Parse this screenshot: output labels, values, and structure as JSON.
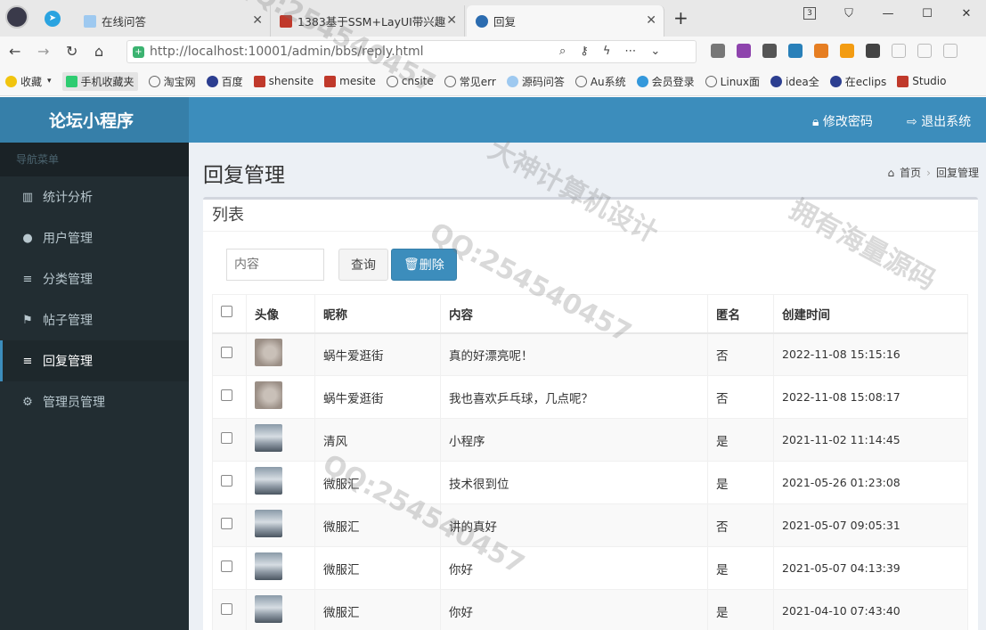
{
  "browser": {
    "tabs": [
      {
        "title": "在线问答"
      },
      {
        "title": "1383基于SSM+LayUI带兴趣"
      },
      {
        "title": "回复"
      }
    ],
    "url": "http://localhost:10001/admin/bbs/reply.html",
    "tab_count_badge": "3",
    "bookmarks": [
      "收藏",
      "手机收藏夹",
      "淘宝网",
      "百度",
      "shensite",
      "mesite",
      "cnsite",
      "常见err",
      "源码问答",
      "Au系统",
      "会员登录",
      "Linux面",
      "idea全",
      "在eclips",
      "Studio"
    ]
  },
  "app": {
    "logo": "论坛小程序",
    "change_password": "修改密码",
    "logout": "退出系统"
  },
  "sidebar": {
    "header": "导航菜单",
    "items": [
      {
        "label": "统计分析",
        "icon": "bar-chart-icon"
      },
      {
        "label": "用户管理",
        "icon": "user-icon"
      },
      {
        "label": "分类管理",
        "icon": "list-icon"
      },
      {
        "label": "帖子管理",
        "icon": "flag-icon"
      },
      {
        "label": "回复管理",
        "icon": "list-icon"
      },
      {
        "label": "管理员管理",
        "icon": "gear-icon"
      }
    ]
  },
  "page": {
    "title": "回复管理",
    "breadcrumb_home": "首页",
    "breadcrumb_current": "回复管理",
    "box_title": "列表",
    "search_placeholder": "内容",
    "query_button": "查询",
    "delete_button": "删除"
  },
  "table": {
    "headers": [
      "头像",
      "昵称",
      "内容",
      "匿名",
      "创建时间"
    ],
    "rows": [
      {
        "avatar": "av1",
        "nickname": "蜗牛爱逛街",
        "content": "真的好漂亮呢！",
        "anonymous": "否",
        "created": "2022-11-08 15:15:16"
      },
      {
        "avatar": "av1",
        "nickname": "蜗牛爱逛街",
        "content": "我也喜欢乒乓球，几点呢？",
        "anonymous": "否",
        "created": "2022-11-08 15:08:17"
      },
      {
        "avatar": "av2",
        "nickname": "清风",
        "content": "小程序",
        "anonymous": "是",
        "created": "2021-11-02 11:14:45"
      },
      {
        "avatar": "av2",
        "nickname": "微服汇",
        "content": "技术很到位",
        "anonymous": "是",
        "created": "2021-05-26 01:23:08"
      },
      {
        "avatar": "av2",
        "nickname": "微服汇",
        "content": "讲的真好",
        "anonymous": "否",
        "created": "2021-05-07 09:05:31"
      },
      {
        "avatar": "av2",
        "nickname": "微服汇",
        "content": "你好",
        "anonymous": "是",
        "created": "2021-05-07 04:13:39"
      },
      {
        "avatar": "av2",
        "nickname": "微服汇",
        "content": "你好",
        "anonymous": "是",
        "created": "2021-04-10 07:43:40"
      }
    ]
  },
  "watermarks": [
    "QQ:254540457",
    "大神计算机设计",
    "拥有海量源码"
  ]
}
